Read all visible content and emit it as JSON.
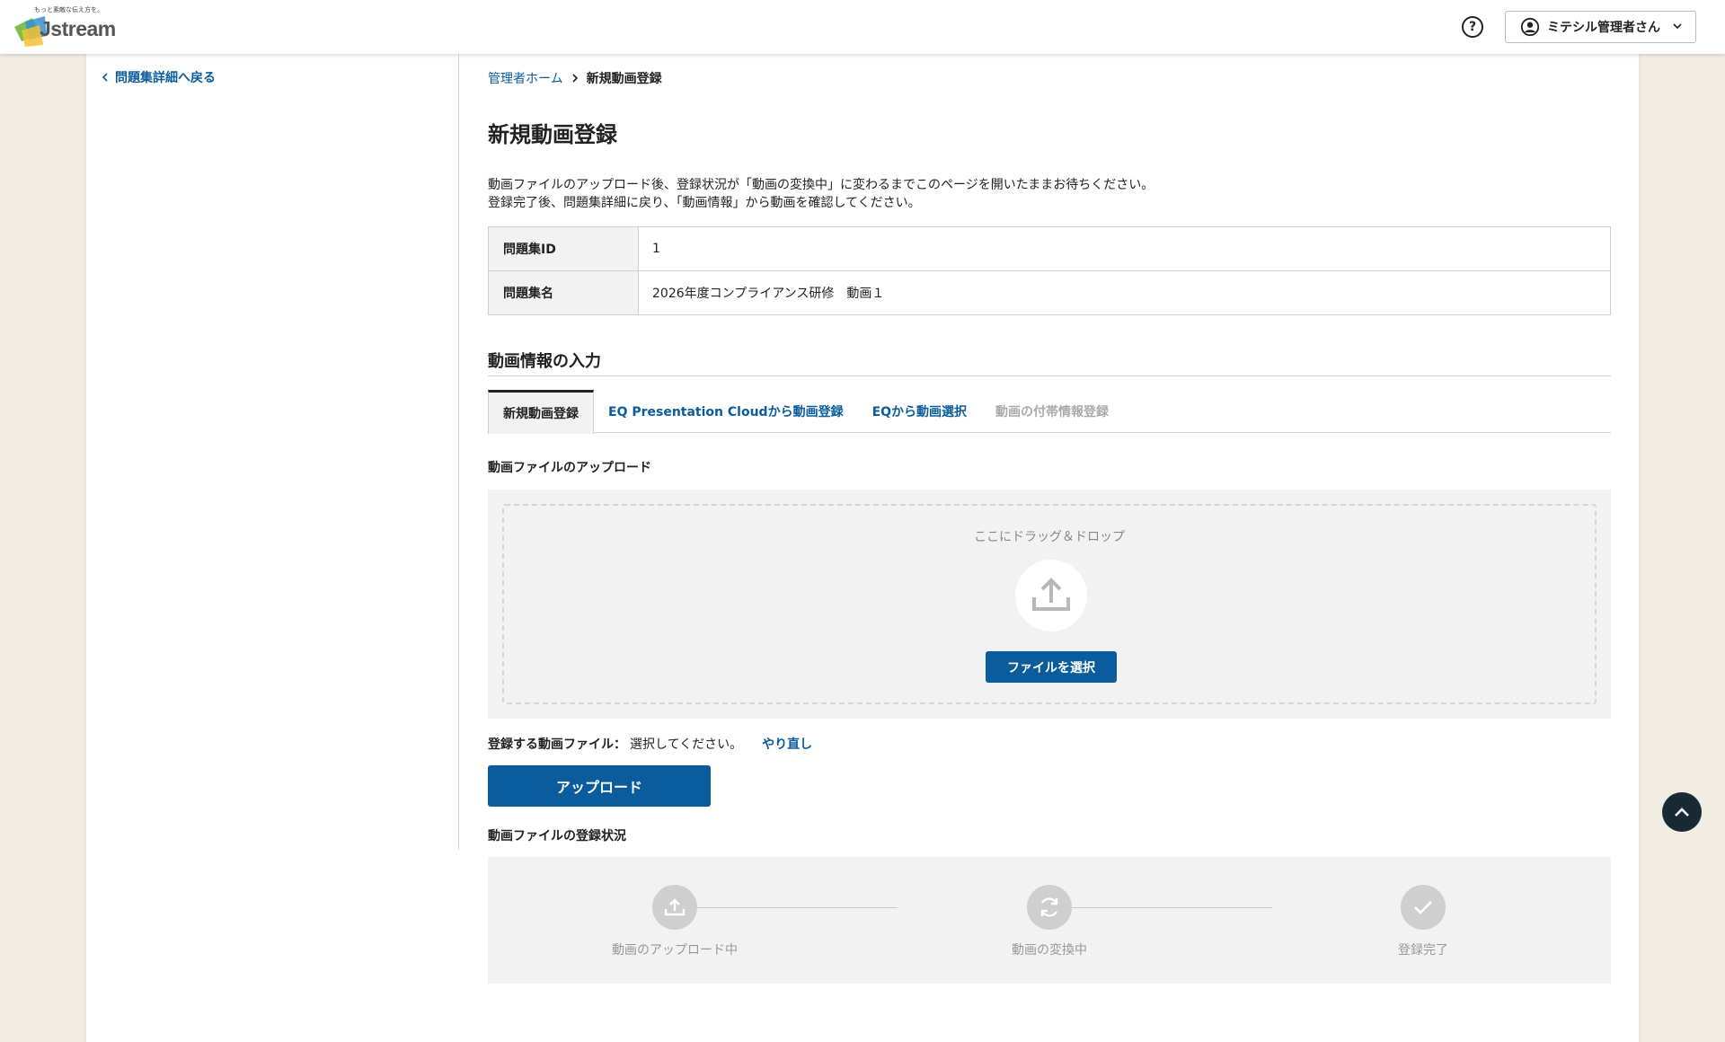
{
  "header": {
    "logo_tagline": "もっと素敵な伝え方を。",
    "logo_text": "Jstream",
    "help_icon": "question-circle-icon",
    "user_name": "ミテシル管理者さん"
  },
  "sidebar": {
    "back_label": "問題集詳細へ戻る"
  },
  "breadcrumb": {
    "home": "管理者ホーム",
    "current": "新規動画登録"
  },
  "page": {
    "title": "新規動画登録",
    "desc_line1": "動画ファイルのアップロード後、登録状況が「動画の変換中」に変わるまでこのページを開いたままお待ちください。",
    "desc_line2": "登録完了後、問題集詳細に戻り、「動画情報」から動画を確認してください。"
  },
  "info": {
    "rows": [
      {
        "label": "問題集ID",
        "value": "1"
      },
      {
        "label": "問題集名",
        "value": "2026年度コンプライアンス研修　動画１"
      }
    ]
  },
  "section": {
    "title": "動画情報の入力"
  },
  "tabs": [
    {
      "label": "新規動画登録",
      "state": "active"
    },
    {
      "label": "EQ Presentation Cloudから動画登録",
      "state": "link"
    },
    {
      "label": "EQから動画選択",
      "state": "link"
    },
    {
      "label": "動画の付帯情報登録",
      "state": "disabled"
    }
  ],
  "upload": {
    "label": "動画ファイルのアップロード",
    "drop_text": "ここにドラッグ＆ドロップ",
    "select_button": "ファイルを選択",
    "file_label": "登録する動画ファイル：",
    "file_value": "選択してください。",
    "redo_label": "やり直し",
    "upload_button": "アップロード"
  },
  "status": {
    "label": "動画ファイルの登録状況",
    "steps": [
      {
        "label": "動画のアップロード中",
        "icon": "upload-icon"
      },
      {
        "label": "動画の変換中",
        "icon": "refresh-icon"
      },
      {
        "label": "登録完了",
        "icon": "check-icon"
      }
    ]
  },
  "colors": {
    "primary": "#0a5c9c",
    "background": "#f1ede3",
    "panel": "#f2f2f2"
  }
}
